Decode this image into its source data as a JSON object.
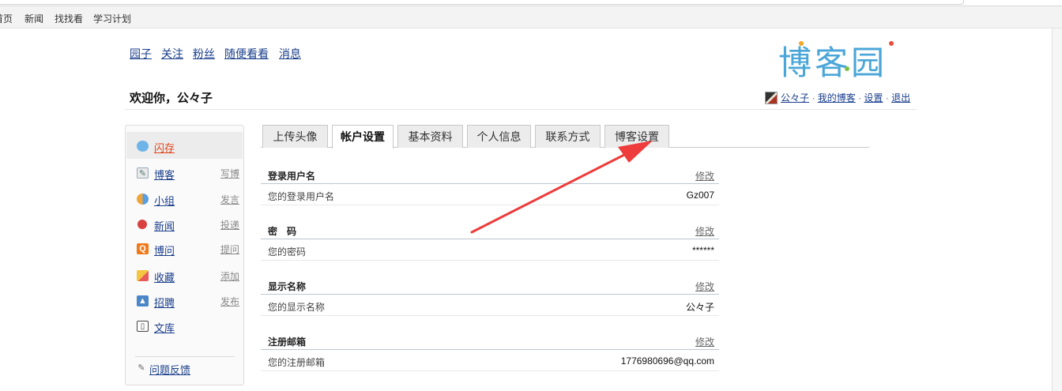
{
  "topnav": {
    "items": [
      "首页",
      "新闻",
      "找找看",
      "学习计划"
    ]
  },
  "sitelinks": [
    "园子",
    "关注",
    "粉丝",
    "随便看看",
    "消息"
  ],
  "logo": {
    "text": "博客园"
  },
  "welcome": {
    "text": "欢迎你，公々子"
  },
  "userbar": {
    "username": "公々子",
    "my_blog": "我的博客",
    "settings": "设置",
    "logout": "退出",
    "separator": "·"
  },
  "sidebar": {
    "items": [
      {
        "label": "闪存",
        "action": "",
        "icon": "chat-bubble-icon"
      },
      {
        "label": "博客",
        "action": "写博",
        "icon": "notepad-icon"
      },
      {
        "label": "小组",
        "action": "发言",
        "icon": "group-icon"
      },
      {
        "label": "新闻",
        "action": "投递",
        "icon": "news-icon"
      },
      {
        "label": "博问",
        "action": "提问",
        "icon": "q-icon"
      },
      {
        "label": "收藏",
        "action": "添加",
        "icon": "bookmark-icon"
      },
      {
        "label": "招聘",
        "action": "发布",
        "icon": "person-card-icon"
      },
      {
        "label": "文库",
        "action": "",
        "icon": "book-icon"
      }
    ],
    "feedback": "问题反馈"
  },
  "tabs": [
    {
      "label": "上传头像"
    },
    {
      "label": "帐户设置",
      "active": true
    },
    {
      "label": "基本资料"
    },
    {
      "label": "个人信息"
    },
    {
      "label": "联系方式"
    },
    {
      "label": "博客设置"
    }
  ],
  "sections": [
    {
      "title": "登录用户名",
      "edit": "修改",
      "desc": "您的登录用户名",
      "value": "Gz007"
    },
    {
      "title": "密　码",
      "edit": "修改",
      "desc": "您的密码",
      "value": "******"
    },
    {
      "title": "显示名称",
      "edit": "修改",
      "desc": "您的显示名称",
      "value": "公々子"
    },
    {
      "title": "注册邮箱",
      "edit": "修改",
      "desc": "您的注册邮箱",
      "value": "1776980696@qq.com"
    }
  ],
  "colors": {
    "link": "#1a3e8c",
    "active_side": "#e0451d",
    "arrow": "#ee3b3b",
    "logo": "#4aa6d8"
  }
}
